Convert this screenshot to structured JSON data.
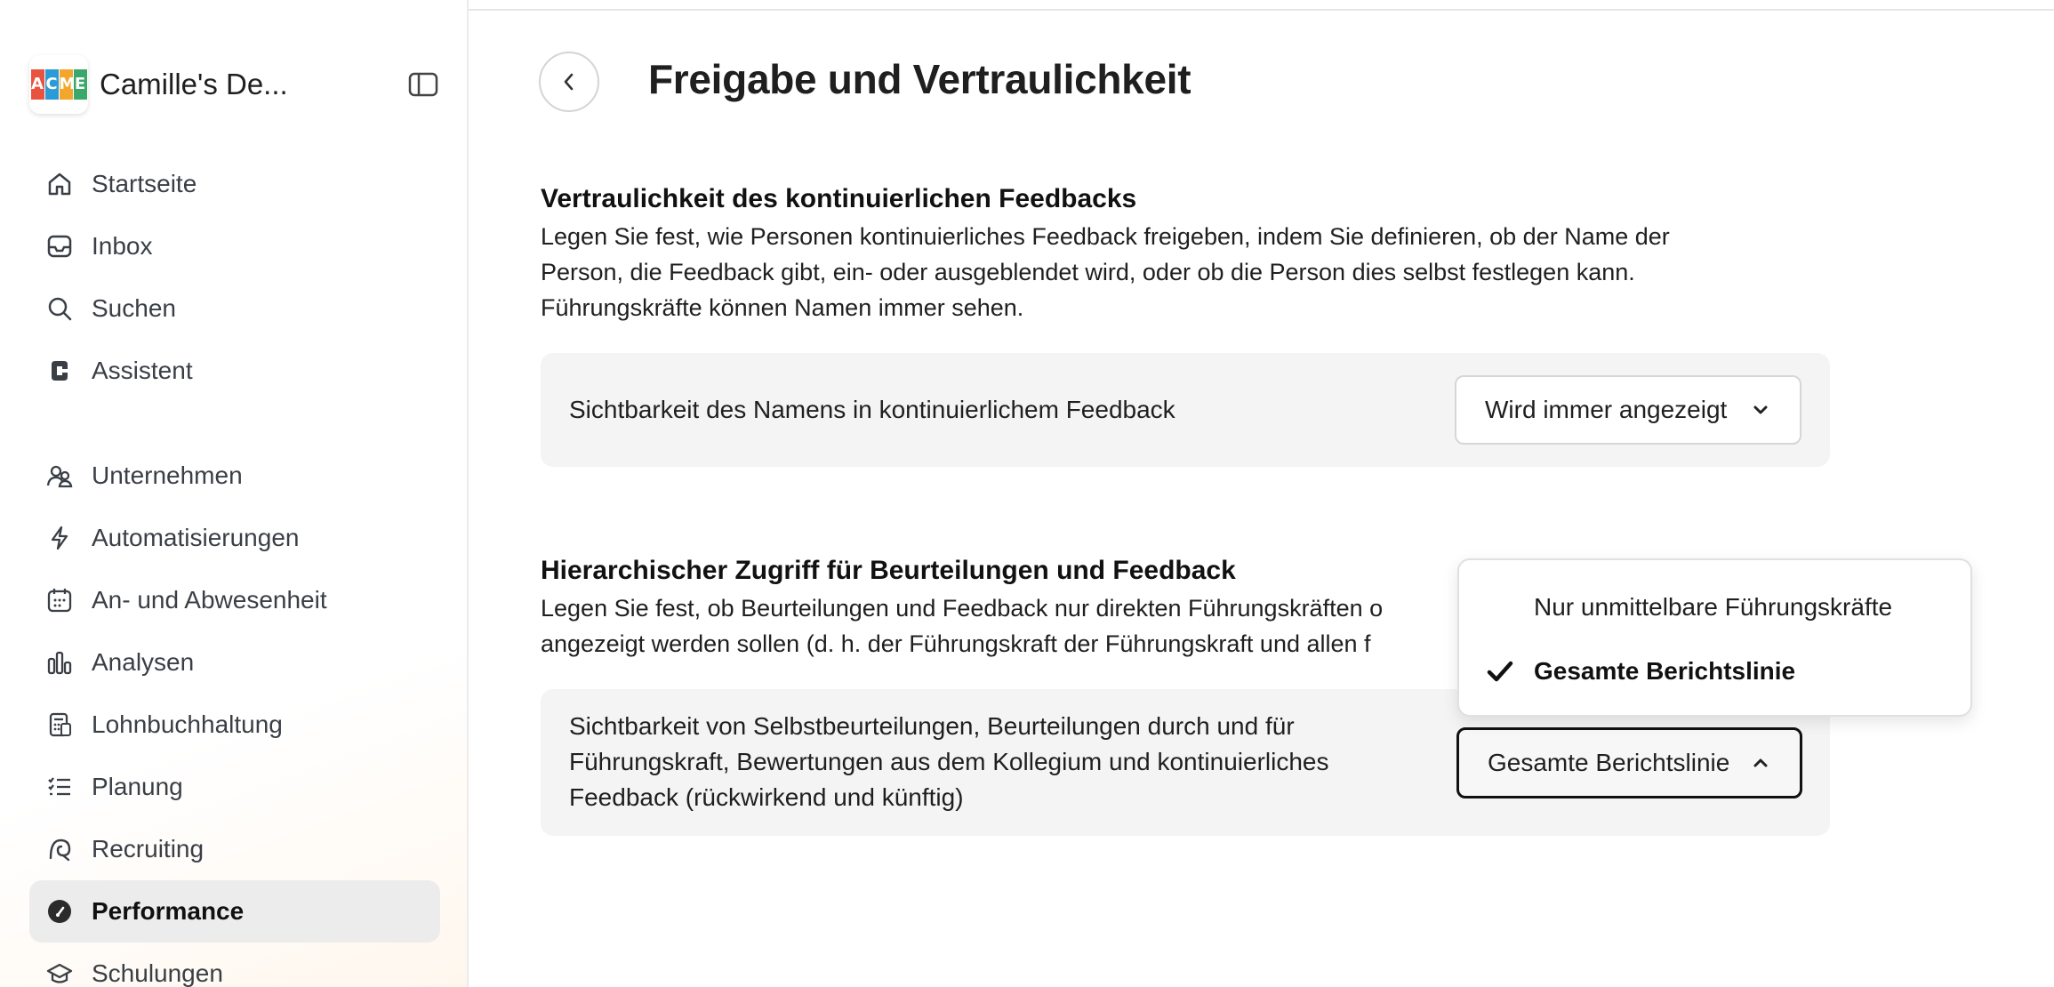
{
  "workspace": {
    "name": "Camille's De...",
    "logo_letters": [
      "A",
      "C",
      "M",
      "E"
    ],
    "logo_colors": [
      "#e8523f",
      "#2b9bd8",
      "#f3a62b",
      "#3aa86b"
    ]
  },
  "sidebar": {
    "items": [
      {
        "label": "Startseite",
        "icon": "home-icon"
      },
      {
        "label": "Inbox",
        "icon": "inbox-icon"
      },
      {
        "label": "Suchen",
        "icon": "search-icon"
      },
      {
        "label": "Assistent",
        "icon": "assistant-icon"
      },
      {
        "label": "Unternehmen",
        "icon": "people-icon"
      },
      {
        "label": "Automatisierungen",
        "icon": "lightning-icon"
      },
      {
        "label": "An- und Abwesenheit",
        "icon": "calendar-icon"
      },
      {
        "label": "Analysen",
        "icon": "bar-chart-icon"
      },
      {
        "label": "Lohnbuchhaltung",
        "icon": "calculator-icon"
      },
      {
        "label": "Planung",
        "icon": "checklist-icon"
      },
      {
        "label": "Recruiting",
        "icon": "recruiting-icon"
      },
      {
        "label": "Performance",
        "icon": "gauge-icon",
        "active": true
      },
      {
        "label": "Schulungen",
        "icon": "graduation-icon"
      }
    ]
  },
  "page": {
    "title": "Freigabe und Vertraulichkeit"
  },
  "section1": {
    "title": "Vertraulichkeit des kontinuierlichen Feedbacks",
    "desc_line1": "Legen Sie fest, wie Personen kontinuierliches Feedback freigeben, indem Sie definieren, ob der Name der",
    "desc_line2": "Person, die Feedback gibt, ein- oder ausgeblendet wird, oder ob die Person dies selbst festlegen kann.",
    "desc_line3": "Führungskräfte können Namen immer sehen.",
    "setting_label": "Sichtbarkeit des Namens in kontinuierlichem Feedback",
    "select_value": "Wird immer angezeigt"
  },
  "section2": {
    "title": "Hierarchischer Zugriff für Beurteilungen und Feedback",
    "desc_line1": "Legen Sie fest, ob Beurteilungen und Feedback nur direkten Führungskräften o",
    "desc_line2": "angezeigt werden sollen (d. h. der Führungskraft der Führungskraft und allen f",
    "setting_label_line1": "Sichtbarkeit von Selbstbeurteilungen, Beurteilungen durch und für",
    "setting_label_line2": "Führungskraft, Bewertungen aus dem Kollegium und kontinuierliches",
    "setting_label_line3": "Feedback (rückwirkend und künftig)",
    "select_value": "Gesamte Berichtslinie",
    "options": [
      {
        "label": "Nur unmittelbare Führungskräfte",
        "selected": false
      },
      {
        "label": "Gesamte Berichtslinie",
        "selected": true
      }
    ]
  }
}
